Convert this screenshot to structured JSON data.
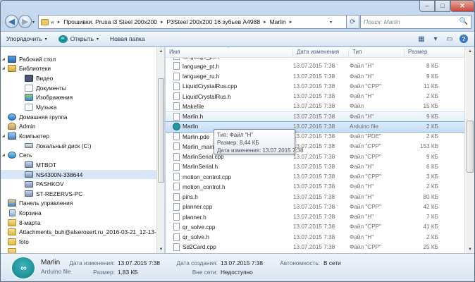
{
  "window": {
    "minimize": "–",
    "maximize": "□",
    "close": "✕"
  },
  "address": {
    "overflow": "«",
    "crumbs": [
      "Прошивки. Prusa i3 Steel 200x200",
      "P3Steel 200x200 16 зубьев A4988",
      "Marlin"
    ],
    "separator": "▸",
    "dropdown": "▾",
    "refresh": "⟳"
  },
  "search": {
    "placeholder": "Поиск: Marlin",
    "icon": "🔍"
  },
  "toolbar": {
    "organize": "Упорядочить",
    "open": "Открыть",
    "open_icon_text": "∞",
    "new_folder": "Новая папка",
    "dropdown": "▾",
    "help": "?"
  },
  "nav": {
    "items": [
      {
        "label": "Рабочий стол",
        "icon": "desktop-icon",
        "level": 0,
        "expand": "◢"
      },
      {
        "label": "Библиотеки",
        "icon": "libraries-icon",
        "level": 0,
        "expand": "◢"
      },
      {
        "label": "Видео",
        "icon": "video-icon",
        "level": 1
      },
      {
        "label": "Документы",
        "icon": "documents-icon",
        "level": 1
      },
      {
        "label": "Изображения",
        "icon": "pictures-icon",
        "level": 1
      },
      {
        "label": "Музыка",
        "icon": "music-icon",
        "level": 1
      },
      {
        "label": "Домашняя группа",
        "icon": "homegroup-icon",
        "level": 0
      },
      {
        "label": "Admin",
        "icon": "user-folder-icon",
        "level": 0
      },
      {
        "label": "Компьютер",
        "icon": "computer-icon",
        "level": 0,
        "expand": "◢"
      },
      {
        "label": "Локальный диск (C:)",
        "icon": "disk-icon",
        "level": 1
      },
      {
        "label": "Сеть",
        "icon": "network-icon",
        "level": 0,
        "expand": "◢"
      },
      {
        "label": "MTBOT",
        "icon": "network-pc-icon",
        "level": 1
      },
      {
        "label": "NS4300N-338644",
        "icon": "network-pc-icon",
        "level": 1,
        "selected": true
      },
      {
        "label": "PASHKOV",
        "icon": "network-pc-icon",
        "level": 1
      },
      {
        "label": "ST-REZERVS-PC",
        "icon": "network-pc-icon",
        "level": 1
      },
      {
        "label": "Панель управления",
        "icon": "control-panel-icon",
        "level": 0
      },
      {
        "label": "Корзина",
        "icon": "recycle-bin-icon",
        "level": 0
      },
      {
        "label": "8-марта",
        "icon": "folder-icon",
        "level": 0
      },
      {
        "label": "Attachments_buh@alserosert.ru_2016-03-21_12-13-4",
        "icon": "folder-icon",
        "level": 0
      },
      {
        "label": "foto",
        "icon": "folder-icon",
        "level": 0
      },
      {
        "label": "",
        "icon": "folder-icon",
        "level": 0
      }
    ]
  },
  "columns": {
    "name": "Имя",
    "date": "Дата изменения",
    "type": "Тип",
    "size": "Размер",
    "sort_arrow": "^"
  },
  "files": [
    {
      "name": "language_pl.h",
      "date": "13.07.2015 7:38",
      "type": "Файл \"H\"",
      "size": "8 КБ"
    },
    {
      "name": "language_pt.h",
      "date": "13.07.2015 7:38",
      "type": "Файл \"H\"",
      "size": "8 КБ"
    },
    {
      "name": "language_ru.h",
      "date": "13.07.2015 7:38",
      "type": "Файл \"H\"",
      "size": "9 КБ"
    },
    {
      "name": "LiquidCrystalRus.cpp",
      "date": "13.07.2015 7:38",
      "type": "Файл \"CPP\"",
      "size": "11 КБ"
    },
    {
      "name": "LiquidCrystalRus.h",
      "date": "13.07.2015 7:38",
      "type": "Файл \"H\"",
      "size": "2 КБ"
    },
    {
      "name": "Makefile",
      "date": "13.07.2015 7:38",
      "type": "Файл",
      "size": "15 КБ"
    },
    {
      "name": "Marlin.h",
      "date": "13.07.2015 7:38",
      "type": "Файл \"H\"",
      "size": "9 КБ",
      "state": "hover"
    },
    {
      "name": "Marlin",
      "date": "13.07.2015 7:38",
      "type": "Arduino file",
      "size": "2 КБ",
      "state": "selected",
      "arduino": true
    },
    {
      "name": "Marlin.pde",
      "date": "13.07.2015 7:38",
      "type": "Файл \"PDE\"",
      "size": "2 КБ"
    },
    {
      "name": "Marlin_main.cpp",
      "date": "13.07.2015 7:38",
      "type": "Файл \"CPP\"",
      "size": "153 КБ"
    },
    {
      "name": "MarlinSerial.cpp",
      "date": "13.07.2015 7:38",
      "type": "Файл \"CPP\"",
      "size": "9 КБ"
    },
    {
      "name": "MarlinSerial.h",
      "date": "13.07.2015 7:38",
      "type": "Файл \"H\"",
      "size": "6 КБ"
    },
    {
      "name": "motion_control.cpp",
      "date": "13.07.2015 7:38",
      "type": "Файл \"CPP\"",
      "size": "3 КБ"
    },
    {
      "name": "motion_control.h",
      "date": "13.07.2015 7:38",
      "type": "Файл \"H\"",
      "size": "2 КБ"
    },
    {
      "name": "pins.h",
      "date": "13.07.2015 7:38",
      "type": "Файл \"H\"",
      "size": "80 КБ"
    },
    {
      "name": "planner.cpp",
      "date": "13.07.2015 7:38",
      "type": "Файл \"CPP\"",
      "size": "42 КБ"
    },
    {
      "name": "planner.h",
      "date": "13.07.2015 7:38",
      "type": "Файл \"H\"",
      "size": "7 КБ"
    },
    {
      "name": "qr_solve.cpp",
      "date": "13.07.2015 7:38",
      "type": "Файл \"CPP\"",
      "size": "41 КБ"
    },
    {
      "name": "qr_solve.h",
      "date": "13.07.2015 7:38",
      "type": "Файл \"H\"",
      "size": "2 КБ"
    },
    {
      "name": "Sd2Card.cpp",
      "date": "13.07.2015 7:38",
      "type": "Файл \"CPP\"",
      "size": "25 КБ"
    }
  ],
  "tooltip": {
    "type_line": "Тип: Файл \"H\"",
    "size_line": "Размер: 8,44 КБ",
    "date_line": "Дата изменения: 13.07.2015 7:38"
  },
  "details": {
    "name": "Marlin",
    "type": "Arduino file",
    "icon_text": "∞",
    "modified_label": "Дата изменения:",
    "modified_value": "13.07.2015 7:38",
    "size_label": "Размер:",
    "size_value": "1,83 КБ",
    "created_label": "Дата создания:",
    "created_value": "13.07.2015 7:38",
    "shared_label": "Вне сети:",
    "shared_value": "Недоступно",
    "offline_label": "Автономность:",
    "offline_value": "В сети"
  },
  "scroll": {
    "up": "▲",
    "down": "▼"
  },
  "colors": {
    "selection": "#c4ddf6",
    "arduino": "#17929a",
    "window_frame": "#b3c9e2"
  }
}
